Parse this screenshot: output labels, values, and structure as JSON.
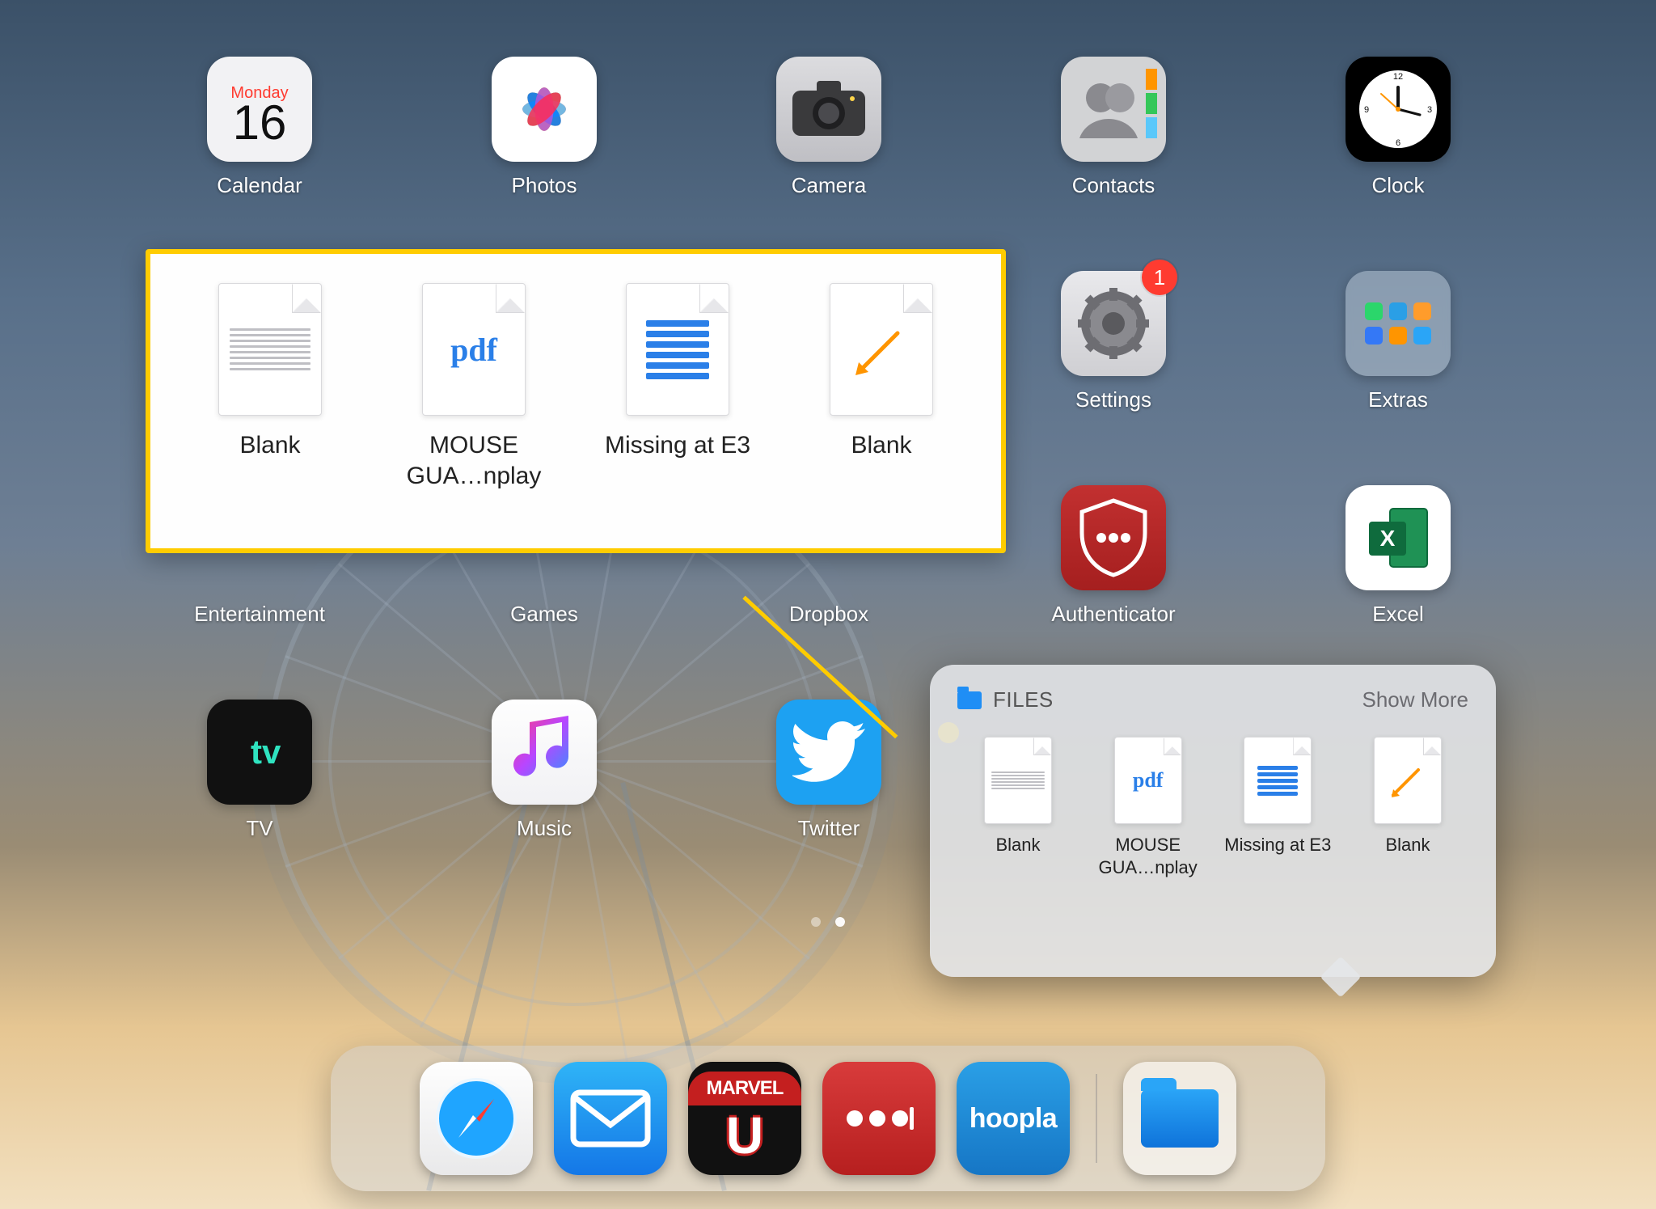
{
  "calendar": {
    "day_of_week": "Monday",
    "day_number": "16"
  },
  "grid_apps": {
    "row1": [
      {
        "label": "Calendar"
      },
      {
        "label": "Photos"
      },
      {
        "label": "Camera"
      },
      {
        "label": "Contacts"
      },
      {
        "label": "Clock"
      }
    ],
    "row2": [
      {
        "label": ""
      },
      {
        "label": ""
      },
      {
        "label": ""
      },
      {
        "label": "Settings",
        "badge": "1"
      },
      {
        "label": "Extras"
      }
    ],
    "row3": [
      {
        "label": "Entertainment"
      },
      {
        "label": "Games"
      },
      {
        "label": "Dropbox"
      },
      {
        "label": "Authenticator"
      },
      {
        "label": "Excel"
      }
    ],
    "row4": [
      {
        "label": "TV"
      },
      {
        "label": "Music"
      },
      {
        "label": "Twitter"
      },
      {
        "label": ""
      },
      {
        "label": ""
      }
    ]
  },
  "callout_files": [
    {
      "name": "Blank",
      "kind": "text"
    },
    {
      "name": "MOUSE GUA…nplay",
      "kind": "pdf"
    },
    {
      "name": "Missing at E3",
      "kind": "lines"
    },
    {
      "name": "Blank",
      "kind": "pencil"
    }
  ],
  "popover": {
    "title": "FILES",
    "show_more": "Show More",
    "items": [
      {
        "name": "Blank",
        "kind": "text"
      },
      {
        "name": "MOUSE GUA…nplay",
        "kind": "pdf"
      },
      {
        "name": "Missing at E3",
        "kind": "lines"
      },
      {
        "name": "Blank",
        "kind": "pencil"
      }
    ]
  },
  "dock": {
    "apps": [
      {
        "name": "Safari"
      },
      {
        "name": "Mail"
      },
      {
        "name": "Marvel Unlimited",
        "top": "MARVEL",
        "letter": "U"
      },
      {
        "name": "More"
      },
      {
        "name": "hoopla",
        "text": "hoopla"
      },
      {
        "name": "Files"
      }
    ]
  },
  "extras_colors": [
    "#2bd66b",
    "#2a9fe6",
    "#ff9c2b",
    "#3478f6",
    "#ff9500",
    "#2aa5f7"
  ]
}
